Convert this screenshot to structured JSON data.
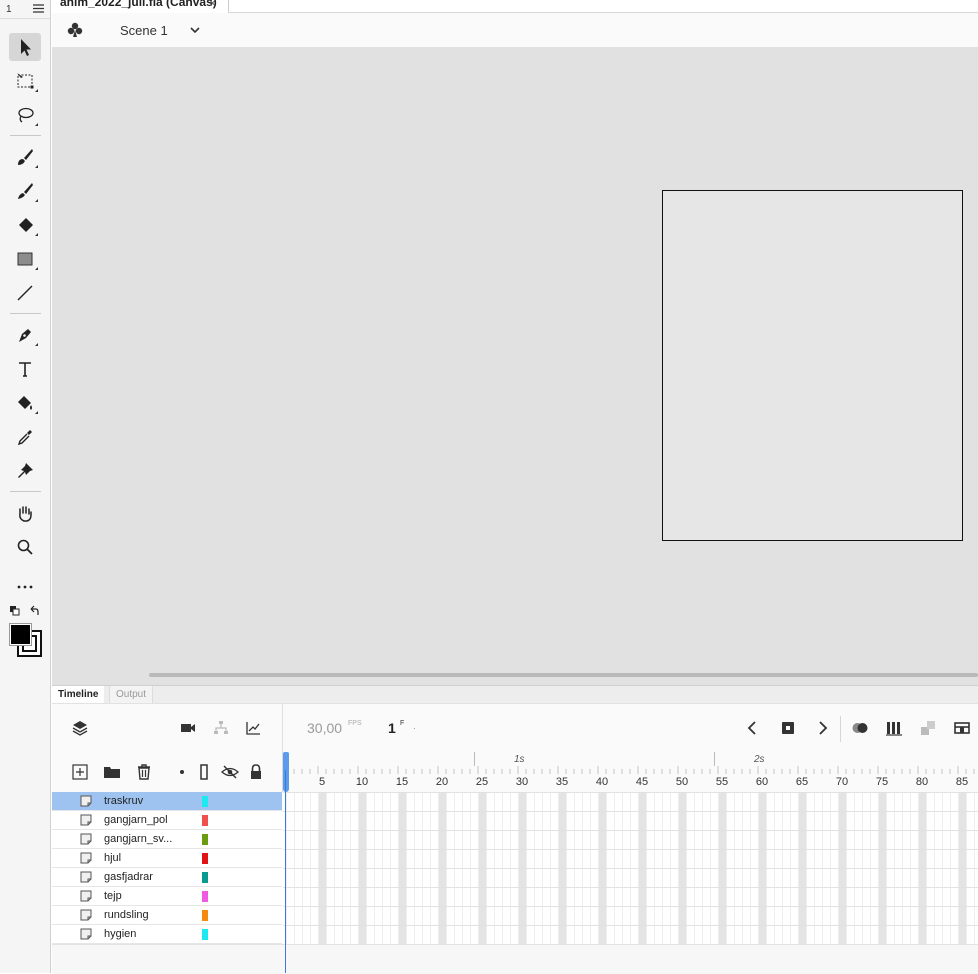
{
  "document": {
    "tab_title": "anim_2022_juli.fla (Canvas)",
    "close_glyph": "×"
  },
  "toolbar": {
    "workspace_number": "1",
    "tools": [
      "selection-tool",
      "free-transform-tool",
      "lasso-tool",
      "fluid-brush-tool",
      "brush-tool",
      "eraser-tool",
      "rectangle-tool",
      "line-tool",
      "pen-tool",
      "text-tool",
      "paint-bucket-tool",
      "eyedropper-tool",
      "pin-tool",
      "hand-tool",
      "zoom-tool",
      "more-tools"
    ],
    "stroke_color": "#000000",
    "fill_color": "#000000"
  },
  "scene": {
    "label": "Scene 1"
  },
  "panel_tabs": {
    "timeline": "Timeline",
    "output": "Output"
  },
  "timeline": {
    "fps": "30,00",
    "fps_unit": "FPS",
    "current_frame": "1",
    "frame_unit": "F",
    "frame_dot": "·",
    "second_labels": [
      "1s",
      "2s"
    ],
    "frame_numbers": [
      "5",
      "10",
      "15",
      "20",
      "25",
      "30",
      "35",
      "40",
      "45",
      "50",
      "55",
      "60",
      "65",
      "70",
      "75",
      "80",
      "85"
    ],
    "layers": [
      {
        "name": "traskruv",
        "color": "#1de9f0",
        "selected": true
      },
      {
        "name": "gangjarn_pol",
        "color": "#f05050",
        "selected": false
      },
      {
        "name": "gangjarn_sv...",
        "color": "#6b9b10",
        "selected": false
      },
      {
        "name": "hjul",
        "color": "#e01515",
        "selected": false
      },
      {
        "name": "gasfjadrar",
        "color": "#0a9a90",
        "selected": false
      },
      {
        "name": "tejp",
        "color": "#f05ae0",
        "selected": false
      },
      {
        "name": "rundsling",
        "color": "#f58a10",
        "selected": false
      },
      {
        "name": "hygien",
        "color": "#1de9f0",
        "selected": false
      }
    ]
  }
}
